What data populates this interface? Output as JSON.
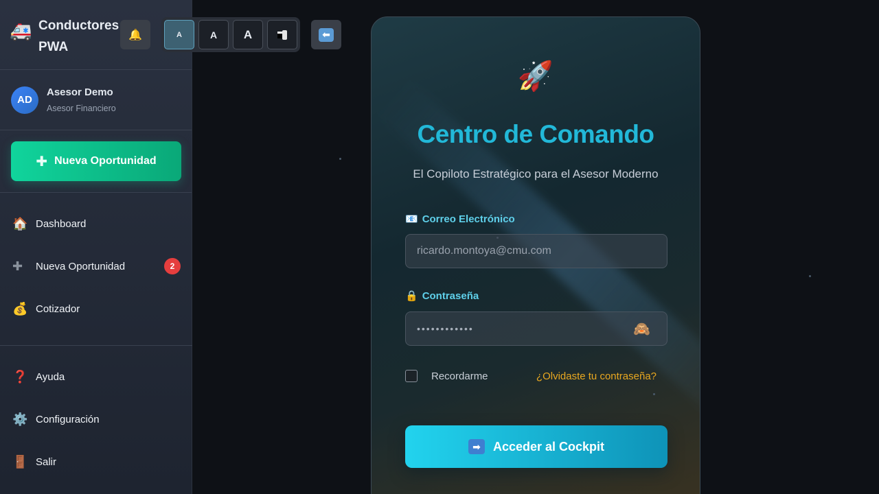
{
  "brand": {
    "title": "Conductores PWA",
    "icon": "ambulance-icon"
  },
  "user": {
    "initials": "AD",
    "name": "Asesor Demo",
    "role": "Asesor Financiero"
  },
  "sidebar": {
    "new_opportunity_label": "Nueva Oportunidad",
    "nav_items": [
      {
        "label": "Dashboard",
        "icon": "house-icon"
      },
      {
        "label": "Nueva Oportunidad",
        "icon": "plus-icon",
        "badge": "2"
      },
      {
        "label": "Cotizador",
        "icon": "money-bag-icon"
      }
    ],
    "bottom_items": [
      {
        "label": "Ayuda",
        "icon": "question-icon"
      },
      {
        "label": "Configuración",
        "icon": "gear-icon"
      },
      {
        "label": "Salir",
        "icon": "door-icon"
      }
    ]
  },
  "toolbar": {
    "font_sizes": [
      "A",
      "A",
      "A"
    ],
    "active_font_index": 0
  },
  "login": {
    "title": "Centro de Comando",
    "subtitle": "El Copiloto Estratégico para el Asesor Moderno",
    "email_label": "Correo Electrónico",
    "email_placeholder": "ricardo.montoya@cmu.com",
    "password_label": "Contraseña",
    "password_value": "••••••••••••",
    "remember_label": "Recordarme",
    "forgot_label": "¿Olvidaste tu contraseña?",
    "submit_label": "Acceder al Cockpit"
  },
  "colors": {
    "accent_cyan": "#22b8d8",
    "accent_green": "#10d49c",
    "link_orange": "#e9a820",
    "badge_red": "#e53e3e"
  }
}
